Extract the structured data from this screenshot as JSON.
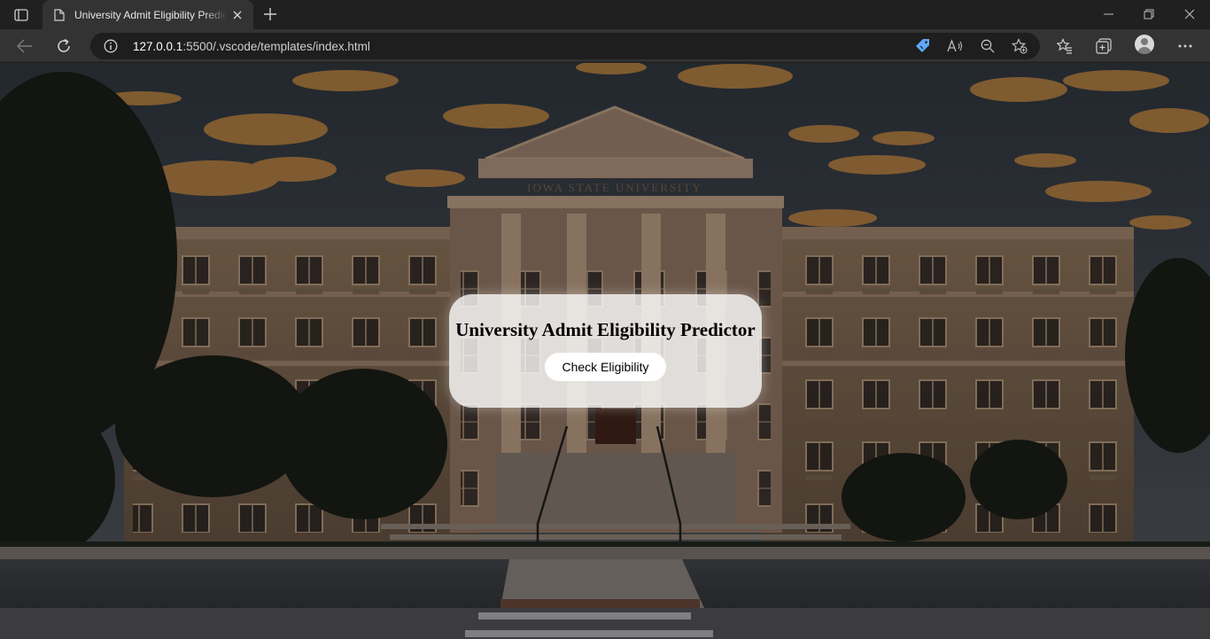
{
  "browser": {
    "tab": {
      "title": "University Admit Eligibility Predictor"
    },
    "address_bar": {
      "host": "127.0.0.1",
      "path": ":5500/.vscode/templates/index.html"
    }
  },
  "page": {
    "building_inscription": "IOWA STATE UNIVERSITY",
    "card": {
      "title": "University Admit Eligibility Predictor",
      "button_label": "Check Eligibility"
    }
  }
}
